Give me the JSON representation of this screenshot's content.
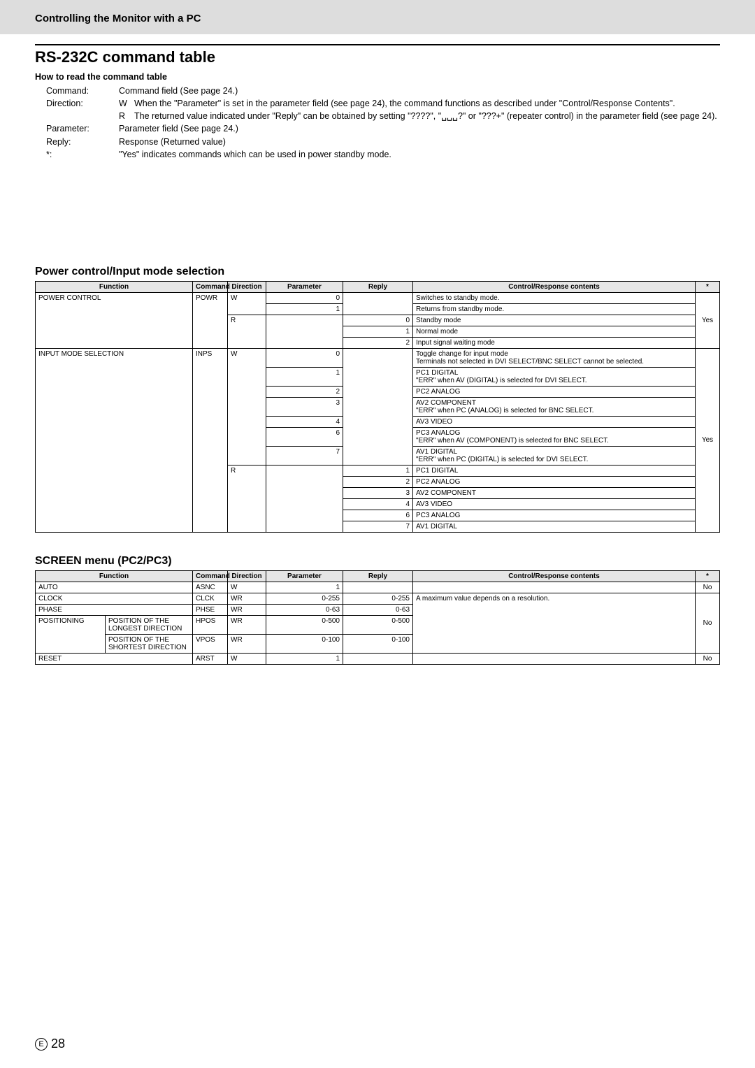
{
  "header": {
    "title": "Controlling the Monitor with a PC"
  },
  "mainTitle": "RS-232C command table",
  "howto": {
    "heading": "How to read the command table",
    "rows": [
      {
        "label": "Command:",
        "text": "Command field (See page 24.)"
      },
      {
        "label": "Direction:",
        "subs": [
          {
            "lead": "W",
            "text": "When the \"Parameter\" is set in the parameter field (see page 24), the command functions as described under \"Control/Response Contents\"."
          },
          {
            "lead": "R",
            "text": "The returned value indicated under \"Reply\" can be obtained by setting \"????\", \"␣␣␣?\" or \"???+\" (repeater control) in the parameter field (see page 24)."
          }
        ]
      },
      {
        "label": "Parameter:",
        "text": "Parameter field (See page 24.)"
      },
      {
        "label": "Reply:",
        "text": "Response (Returned value)"
      },
      {
        "label": "*:",
        "text": "\"Yes\" indicates commands which can be used in power standby mode."
      }
    ]
  },
  "sections": {
    "power": {
      "heading": "Power control/Input mode selection",
      "headers": [
        "Function",
        "Command",
        "Direction",
        "Parameter",
        "Reply",
        "Control/Response contents",
        "*"
      ],
      "rows": [
        {
          "f": "POWER CONTROL",
          "c": "POWR",
          "d": "W",
          "p": "0",
          "r": "",
          "desc": "Switches to standby mode.",
          "star": ""
        },
        {
          "f": "",
          "c": "",
          "d": "",
          "p": "1",
          "r": "",
          "desc": "Returns from standby mode.",
          "star": ""
        },
        {
          "f": "",
          "c": "",
          "d": "R",
          "p": "",
          "r": "0",
          "desc": "Standby mode",
          "star": "Yes"
        },
        {
          "f": "",
          "c": "",
          "d": "",
          "p": "",
          "r": "1",
          "desc": "Normal mode",
          "star": ""
        },
        {
          "f": "",
          "c": "",
          "d": "",
          "p": "",
          "r": "2",
          "desc": "Input signal waiting mode",
          "star": ""
        },
        {
          "f": "INPUT MODE SELECTION",
          "c": "INPS",
          "d": "W",
          "p": "0",
          "r": "",
          "desc": "Toggle change for input mode\nTerminals not selected in DVI SELECT/BNC SELECT cannot be selected.",
          "star": ""
        },
        {
          "f": "",
          "c": "",
          "d": "",
          "p": "1",
          "r": "",
          "desc": "PC1 DIGITAL\n\"ERR\" when AV (DIGITAL) is selected for DVI SELECT.",
          "star": ""
        },
        {
          "f": "",
          "c": "",
          "d": "",
          "p": "2",
          "r": "",
          "desc": "PC2 ANALOG",
          "star": ""
        },
        {
          "f": "",
          "c": "",
          "d": "",
          "p": "3",
          "r": "",
          "desc": "AV2 COMPONENT\n\"ERR\" when PC (ANALOG) is selected for BNC SELECT.",
          "star": ""
        },
        {
          "f": "",
          "c": "",
          "d": "",
          "p": "4",
          "r": "",
          "desc": "AV3 VIDEO",
          "star": ""
        },
        {
          "f": "",
          "c": "",
          "d": "",
          "p": "6",
          "r": "",
          "desc": "PC3 ANALOG\n\"ERR\" when AV (COMPONENT) is selected for BNC SELECT.",
          "star": "Yes"
        },
        {
          "f": "",
          "c": "",
          "d": "",
          "p": "7",
          "r": "",
          "desc": "AV1 DIGITAL\n\"ERR\" when PC (DIGITAL) is selected for DVI SELECT.",
          "star": ""
        },
        {
          "f": "",
          "c": "",
          "d": "R",
          "p": "",
          "r": "1",
          "desc": "PC1 DIGITAL",
          "star": ""
        },
        {
          "f": "",
          "c": "",
          "d": "",
          "p": "",
          "r": "2",
          "desc": "PC2 ANALOG",
          "star": ""
        },
        {
          "f": "",
          "c": "",
          "d": "",
          "p": "",
          "r": "3",
          "desc": "AV2 COMPONENT",
          "star": ""
        },
        {
          "f": "",
          "c": "",
          "d": "",
          "p": "",
          "r": "4",
          "desc": "AV3 VIDEO",
          "star": ""
        },
        {
          "f": "",
          "c": "",
          "d": "",
          "p": "",
          "r": "6",
          "desc": "PC3 ANALOG",
          "star": ""
        },
        {
          "f": "",
          "c": "",
          "d": "",
          "p": "",
          "r": "7",
          "desc": "AV1 DIGITAL",
          "star": ""
        }
      ]
    },
    "screen": {
      "heading": "SCREEN menu (PC2/PC3)",
      "headers": [
        "Function",
        "Command",
        "Direction",
        "Parameter",
        "Reply",
        "Control/Response contents",
        "*"
      ],
      "rows": [
        {
          "f1": "AUTO",
          "f2": "",
          "c": "ASNC",
          "d": "W",
          "p": "1",
          "r": "",
          "desc": "",
          "star": "No"
        },
        {
          "f1": "CLOCK",
          "f2": "",
          "c": "CLCK",
          "d": "WR",
          "p": "0-255",
          "r": "0-255",
          "desc": "",
          "star": ""
        },
        {
          "f1": "PHASE",
          "f2": "",
          "c": "PHSE",
          "d": "WR",
          "p": "0-63",
          "r": "0-63",
          "desc": "",
          "star": ""
        },
        {
          "f1": "POSITIONING",
          "f2": "POSITION OF THE LONGEST DIRECTION",
          "c": "HPOS",
          "d": "WR",
          "p": "0-500",
          "r": "0-500",
          "desc": "A maximum value depends on a resolution.",
          "star": "No"
        },
        {
          "f1": "",
          "f2": "POSITION OF THE SHORTEST DIRECTION",
          "c": "VPOS",
          "d": "WR",
          "p": "0-100",
          "r": "0-100",
          "desc": "",
          "star": ""
        },
        {
          "f1": "RESET",
          "f2": "",
          "c": "ARST",
          "d": "W",
          "p": "1",
          "r": "",
          "desc": "",
          "star": "No"
        }
      ]
    }
  },
  "footer": {
    "circ": "E",
    "page": "28"
  }
}
